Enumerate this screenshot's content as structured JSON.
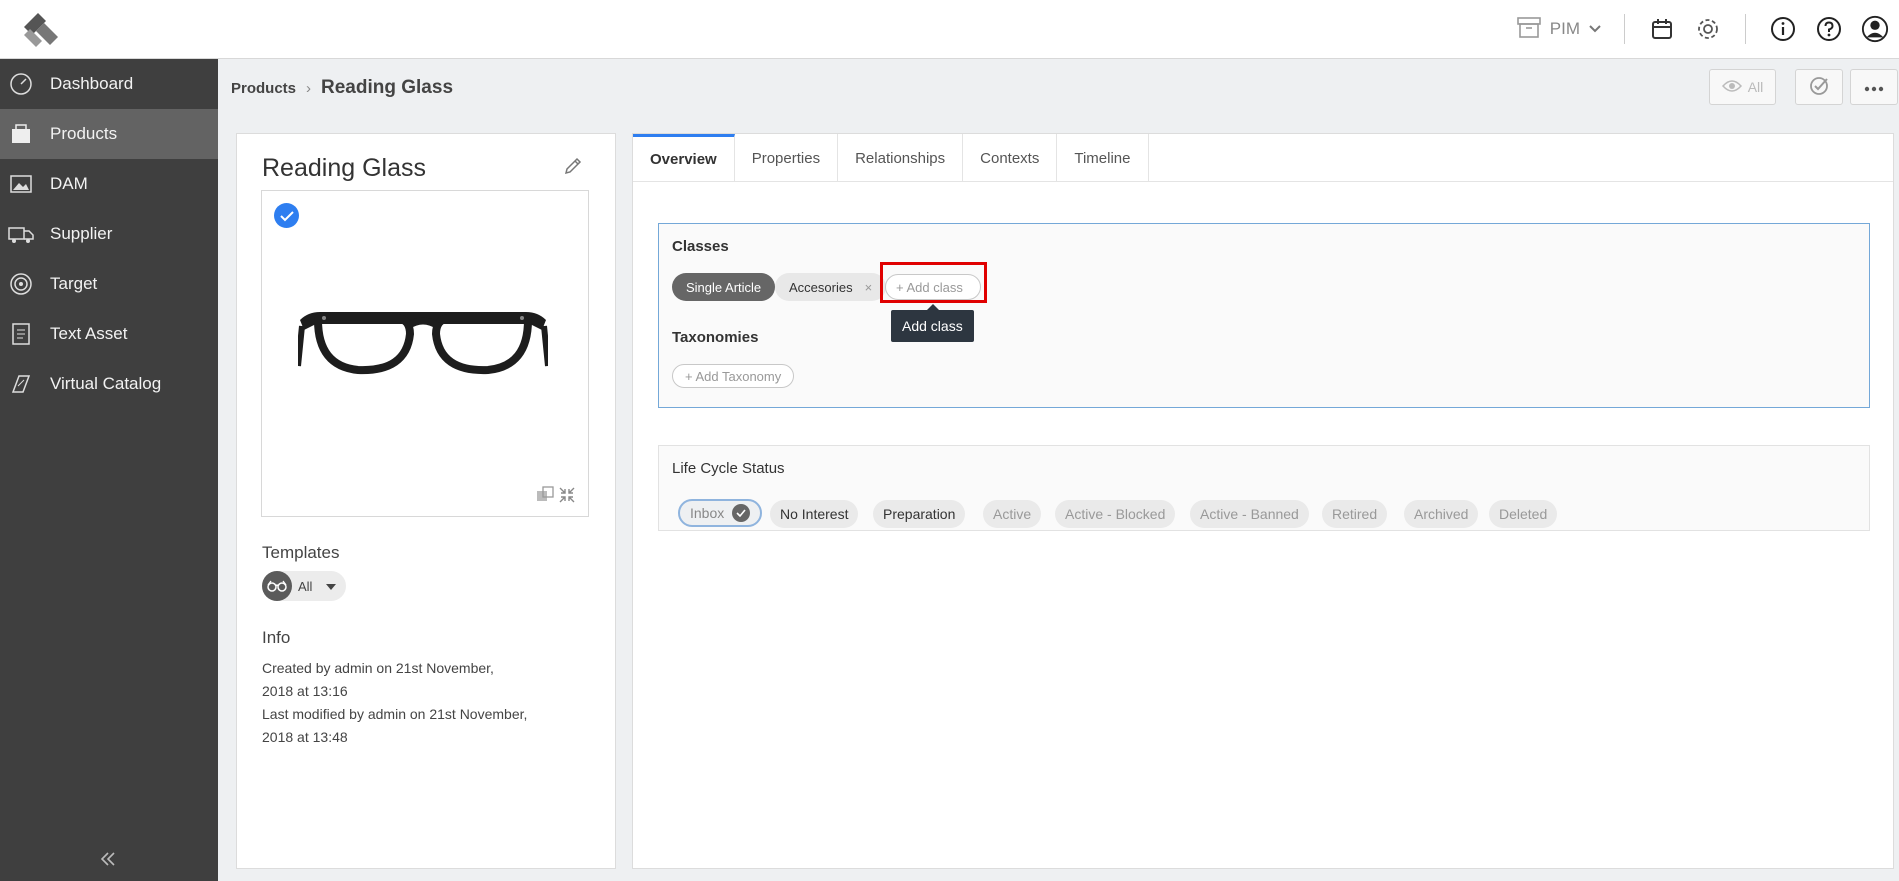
{
  "topbar": {
    "app_switch_label": "PIM"
  },
  "sidebar": {
    "items": [
      {
        "label": "Dashboard",
        "icon": "dashboard-icon"
      },
      {
        "label": "Products",
        "icon": "products-icon"
      },
      {
        "label": "DAM",
        "icon": "image-icon"
      },
      {
        "label": "Supplier",
        "icon": "truck-icon"
      },
      {
        "label": "Target",
        "icon": "target-icon"
      },
      {
        "label": "Text Asset",
        "icon": "document-icon"
      },
      {
        "label": "Virtual Catalog",
        "icon": "catalog-icon"
      }
    ]
  },
  "breadcrumb": {
    "parent": "Products",
    "separator": "›",
    "current": "Reading Glass"
  },
  "header_actions": {
    "view_filter_label": "All"
  },
  "product": {
    "title": "Reading Glass",
    "templates_heading": "Templates",
    "template_value": "All",
    "info_heading": "Info",
    "info_lines": [
      [
        "Created by ",
        "admin",
        " on ",
        "21st November,"
      ],
      [
        "2018",
        " at ",
        "13:16"
      ],
      [
        "Last modified by ",
        "admin",
        " on ",
        "21st November,"
      ],
      [
        "2018",
        " at ",
        "13:48"
      ]
    ]
  },
  "tabs": [
    "Overview",
    "Properties",
    "Relationships",
    "Contexts",
    "Timeline"
  ],
  "classes": {
    "heading": "Classes",
    "chips": [
      "Single Article",
      "Accesories"
    ],
    "remove_symbol": "×",
    "add_label": "+  Add class",
    "tooltip": "Add class"
  },
  "taxonomies": {
    "heading": "Taxonomies",
    "add_label": "+  Add Taxonomy"
  },
  "lifecycle": {
    "heading": "Life Cycle Status",
    "statuses": [
      "Inbox",
      "No Interest",
      "Preparation",
      "Active",
      "Active - Blocked",
      "Active - Banned",
      "Retired",
      "Archived",
      "Deleted"
    ],
    "selected": "Inbox"
  },
  "colors": {
    "accent": "#2e7ef0",
    "sidebar_bg": "#3f3f3f",
    "highlight": "#e00000"
  }
}
